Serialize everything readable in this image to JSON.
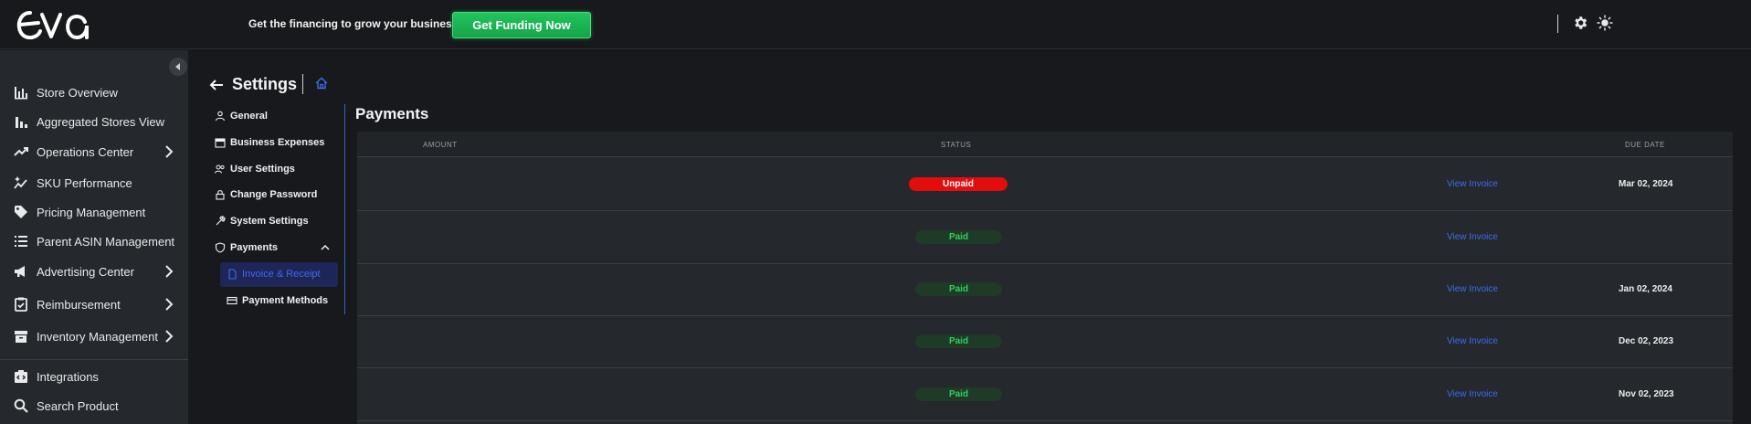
{
  "topbar": {
    "promo_text": "Get the financing to grow your business!",
    "funding_button": "Get Funding Now"
  },
  "sidebar": {
    "items": [
      {
        "label": "Store Overview",
        "icon": "bar-chart-icon"
      },
      {
        "label": "Aggregated Stores View",
        "icon": "bar-chart-alt-icon"
      },
      {
        "label": "Operations Center",
        "icon": "trending-up-icon",
        "expandable": true
      },
      {
        "label": "SKU Performance",
        "icon": "sparkle-chart-icon"
      },
      {
        "label": "Pricing Management",
        "icon": "tag-icon"
      },
      {
        "label": "Parent ASIN Management",
        "icon": "list-icon"
      },
      {
        "label": "Advertising Center",
        "icon": "megaphone-icon",
        "expandable": true
      },
      {
        "label": "Reimbursement",
        "icon": "clipboard-check-icon",
        "expandable": true
      },
      {
        "label": "Inventory Management",
        "icon": "archive-box-icon",
        "expandable": true
      },
      {
        "label": "Integrations",
        "icon": "integration-icon"
      },
      {
        "label": "Search Product",
        "icon": "search-icon"
      }
    ]
  },
  "settings": {
    "title": "Settings",
    "menu": [
      {
        "label": "General",
        "icon": "user-icon"
      },
      {
        "label": "Business Expenses",
        "icon": "calendar-icon"
      },
      {
        "label": "User Settings",
        "icon": "users-icon"
      },
      {
        "label": "Change Password",
        "icon": "lock-icon"
      },
      {
        "label": "System Settings",
        "icon": "wrench-icon"
      },
      {
        "label": "Payments",
        "icon": "shield-icon"
      },
      {
        "label": "Invoice & Receipt",
        "icon": "document-icon"
      },
      {
        "label": "Payment Methods",
        "icon": "credit-card-icon"
      }
    ]
  },
  "payments": {
    "title": "Payments",
    "columns": {
      "amount": "AMOUNT",
      "status": "STATUS",
      "due_date": "DUE DATE"
    },
    "rows": [
      {
        "status": "Unpaid",
        "link": "View Invoice",
        "due": "Mar 02, 2024"
      },
      {
        "status": "Paid",
        "link": "View Invoice",
        "due": ""
      },
      {
        "status": "Paid",
        "link": "View Invoice",
        "due": "Jan 02, 2024"
      },
      {
        "status": "Paid",
        "link": "View Invoice",
        "due": "Dec 02, 2023"
      },
      {
        "status": "Paid",
        "link": "View Invoice",
        "due": "Nov 02, 2023"
      }
    ]
  },
  "colors": {
    "accent": "#3b6cf0",
    "funding_green": "#22c55e",
    "unpaid_red": "#e30d0d",
    "paid_green": "#2fd35a"
  }
}
